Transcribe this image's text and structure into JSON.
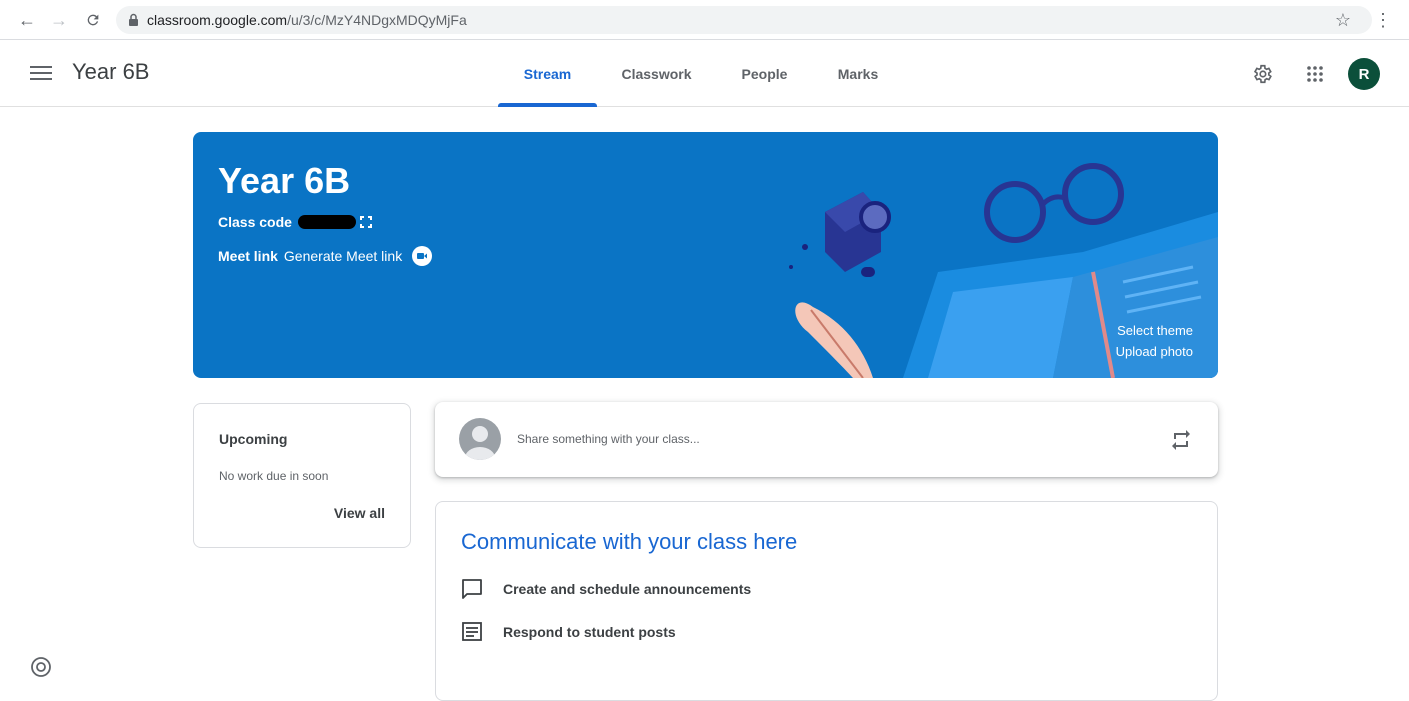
{
  "browser": {
    "url_host": "classroom.google.com",
    "url_path": "/u/3/c/MzY4NDgxMDQyMjFa"
  },
  "header": {
    "class_title": "Year 6B",
    "tabs": [
      {
        "label": "Stream",
        "active": true
      },
      {
        "label": "Classwork",
        "active": false
      },
      {
        "label": "People",
        "active": false
      },
      {
        "label": "Marks",
        "active": false
      }
    ],
    "avatar_initial": "R"
  },
  "banner": {
    "title": "Year 6B",
    "class_code_label": "Class code",
    "meet_link_label": "Meet link",
    "meet_link_action": "Generate Meet link",
    "select_theme": "Select theme",
    "upload_photo": "Upload photo",
    "background_color": "#0a74c5"
  },
  "upcoming": {
    "title": "Upcoming",
    "subtitle": "No work due in soon",
    "view_all": "View all"
  },
  "share": {
    "placeholder": "Share something with your class..."
  },
  "communicate": {
    "title": "Communicate with your class here",
    "items": [
      {
        "icon": "announcement-icon",
        "label": "Create and schedule announcements"
      },
      {
        "icon": "posts-icon",
        "label": "Respond to student posts"
      }
    ]
  },
  "colors": {
    "accent": "#1967d2",
    "avatar_bg": "#0b4f3a"
  }
}
